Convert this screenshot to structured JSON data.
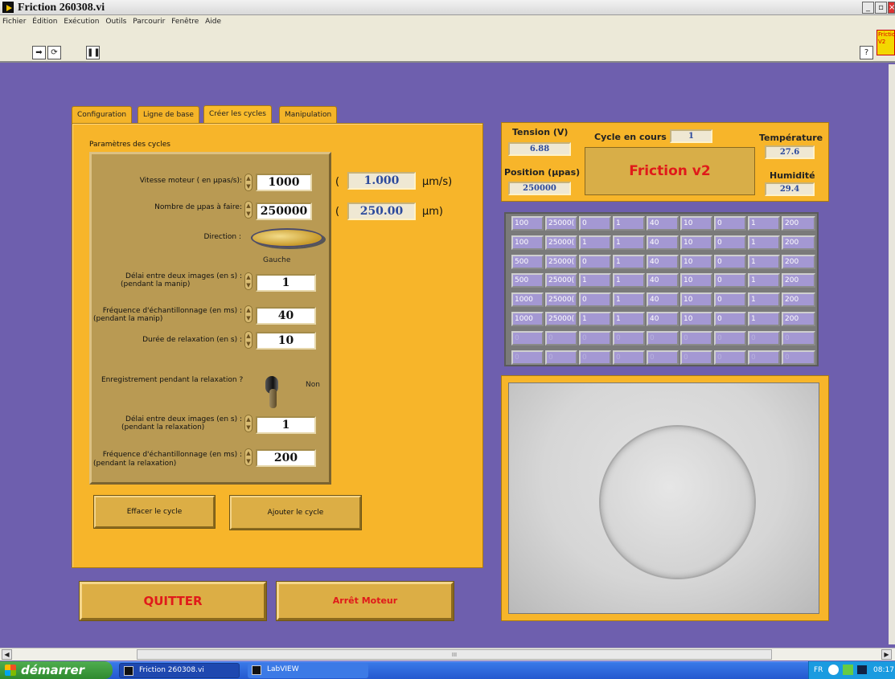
{
  "window": {
    "title": "Friction 260308.vi"
  },
  "menu": [
    "Fichier",
    "Édition",
    "Exécution",
    "Outils",
    "Parcourir",
    "Fenêtre",
    "Aide"
  ],
  "vi_tag": "Friction V2",
  "tabs": [
    "Configuration",
    "Ligne de base",
    "Créer les cycles",
    "Manipulation"
  ],
  "active_tab": "Créer les cycles",
  "cycles": {
    "section_title": "Paramètres des cycles",
    "speed": {
      "label": "Vitesse moteur ( en µpas/s):",
      "value": "1000",
      "converted": "1.000",
      "unit": "µm/s)"
    },
    "steps": {
      "label": "Nombre de µpas à faire:",
      "value": "250000",
      "converted": "250.00",
      "unit": "µm)"
    },
    "paren": "(",
    "direction": {
      "label": "Direction :",
      "value": "Gauche"
    },
    "delay_manip": {
      "label1": "Délai entre deux images (en s) :",
      "label2": "(pendant la manip)",
      "value": "1"
    },
    "freq_manip": {
      "label1": "Fréquence d'échantillonnage (en ms) :",
      "label2": "(pendant la manip)",
      "value": "40"
    },
    "relax_duration": {
      "label": "Durée de relaxation (en s) :",
      "value": "10"
    },
    "record_relax": {
      "label": "Enregistrement pendant la relaxation ?",
      "value": "Non"
    },
    "delay_relax": {
      "label1": "Délai entre deux images (en s) :",
      "label2": "(pendant la relaxation)",
      "value": "1"
    },
    "freq_relax": {
      "label1": "Fréquence d'échantillonnage (en ms) :",
      "label2": "(pendant la relaxation)",
      "value": "200"
    },
    "clear_button": "Effacer le cycle",
    "add_button": "Ajouter le cycle"
  },
  "quit_button": "QUITTER",
  "stop_motor_button": "Arrêt Moteur",
  "status": {
    "tension_label": "Tension (V)",
    "tension": "6.88",
    "cycle_label": "Cycle en cours",
    "cycle": "1",
    "temperature_label": "Température",
    "temperature": "27.6",
    "position_label": "Position (µpas)",
    "position": "250000",
    "humidity_label": "Humidité",
    "humidity": "29.4",
    "name": "Friction v2"
  },
  "cycle_table": [
    [
      "100",
      "25000(",
      "0",
      "1",
      "40",
      "10",
      "0",
      "1",
      "200"
    ],
    [
      "100",
      "25000(",
      "1",
      "1",
      "40",
      "10",
      "0",
      "1",
      "200"
    ],
    [
      "500",
      "25000(",
      "0",
      "1",
      "40",
      "10",
      "0",
      "1",
      "200"
    ],
    [
      "500",
      "25000(",
      "1",
      "1",
      "40",
      "10",
      "0",
      "1",
      "200"
    ],
    [
      "1000",
      "25000(",
      "0",
      "1",
      "40",
      "10",
      "0",
      "1",
      "200"
    ],
    [
      "1000",
      "25000(",
      "1",
      "1",
      "40",
      "10",
      "0",
      "1",
      "200"
    ],
    [
      "0",
      "0",
      "0",
      "0",
      "0",
      "0",
      "0",
      "0",
      "0"
    ],
    [
      "0",
      "0",
      "0",
      "0",
      "0",
      "0",
      "0",
      "0",
      "0"
    ]
  ],
  "taskbar": {
    "start": "démarrer",
    "tasks": [
      "Friction 260308.vi",
      "LabVIEW"
    ],
    "lang": "FR",
    "clock": "08:17"
  },
  "scroll_marker": "III",
  "colors": {
    "background": "#6e5fae",
    "panel": "#f7b52a",
    "accent_red": "#e01a1a",
    "indicator_text": "#2c4a9c"
  }
}
